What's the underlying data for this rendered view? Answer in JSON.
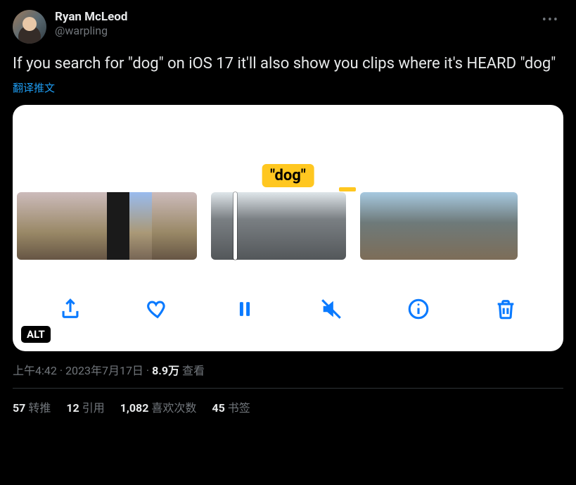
{
  "author": {
    "display_name": "Ryan McLeod",
    "handle": "@warpling"
  },
  "body": "If you search for \"dog\" on iOS 17 it'll also show you clips where it's HEARD \"dog\"",
  "translate_label": "翻译推文",
  "media": {
    "search_label": "\"dog\"",
    "alt_badge": "ALT",
    "toolbar_icons": [
      "share-icon",
      "heart-icon",
      "pause-icon",
      "mute-icon",
      "info-icon",
      "trash-icon"
    ]
  },
  "meta": {
    "time": "上午4:42",
    "date": "2023年7月17日",
    "views_value": "8.9万",
    "views_label": "查看"
  },
  "stats": {
    "retweets": {
      "value": "57",
      "label": "转推"
    },
    "quotes": {
      "value": "12",
      "label": "引用"
    },
    "likes": {
      "value": "1,082",
      "label": "喜欢次数"
    },
    "bookmarks": {
      "value": "45",
      "label": "书签"
    }
  }
}
